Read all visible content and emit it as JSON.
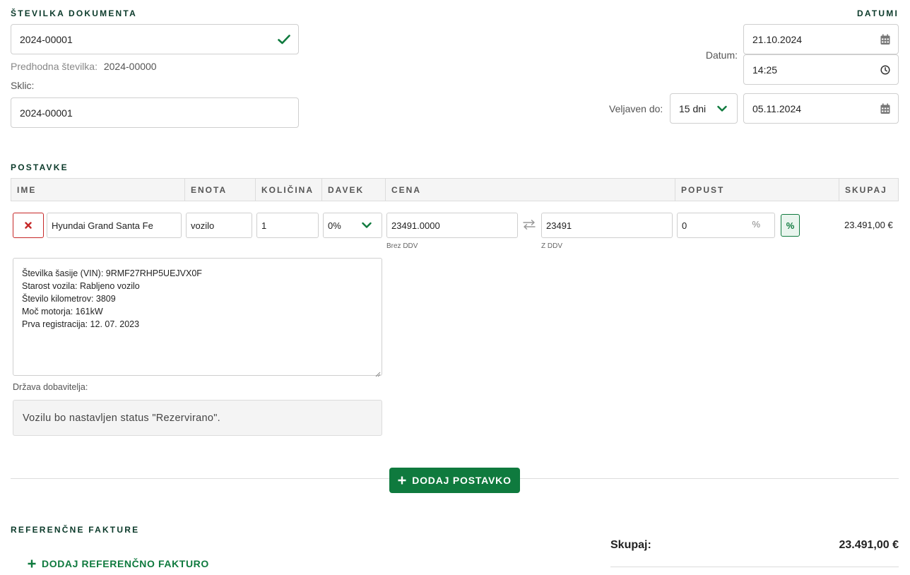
{
  "document": {
    "heading": "ŠTEVILKA DOKUMENTA",
    "number_value": "2024-00001",
    "previous_label": "Predhodna številka:",
    "previous_value": "2024-00000",
    "reference_label": "Sklic:",
    "reference_value": "2024-00001"
  },
  "dates": {
    "heading": "DATUMI",
    "date_label": "Datum:",
    "date_value": "21.10.2024",
    "time_value": "14:25",
    "valid_label": "Veljaven do:",
    "valid_days": "15 dni",
    "valid_date": "05.11.2024"
  },
  "items": {
    "heading": "POSTAVKE",
    "columns": [
      "IME",
      "ENOTA",
      "KOLIČINA",
      "DAVEK",
      "CENA",
      "POPUST",
      "SKUPAJ"
    ],
    "row": {
      "name": "Hyundai Grand Santa Fe",
      "unit": "vozilo",
      "quantity": "1",
      "tax": "0%",
      "price_net": "23491.0000",
      "price_net_note": "Brez DDV",
      "price_gross": "23491",
      "price_gross_note": "Z DDV",
      "discount": "0",
      "discount_unit": "%",
      "discount_toggle": "%",
      "total": "23.491,00 €",
      "description": "Številka šasije (VIN): 9RMF27RHP5UEJVX0F\nStarost vozila: Rabljeno vozilo\nŠtevilo kilometrov: 3809\nMoč motorja: 161kW\nPrva registracija: 12. 07. 2023",
      "supplier_country_label": "Država dobavitelja:",
      "status_notice": "Vozilu bo nastavljen status \"Rezervirano\"."
    },
    "add_button": "DODAJ POSTAVKO"
  },
  "reference_invoices": {
    "heading": "REFERENČNE FAKTURE",
    "add_link": "DODAJ REFERENČNO FAKTURO"
  },
  "summary": {
    "total_label": "Skupaj:",
    "total_value": "23.491,00 €"
  },
  "colors": {
    "accent": "#0f7a3e",
    "danger": "#c62828",
    "heading": "#0b3a2a"
  },
  "icons": {
    "check": "check-icon",
    "calendar": "calendar-icon",
    "clock": "clock-icon",
    "chevron": "chevron-down-icon",
    "remove": "close-icon",
    "swap": "swap-arrows-icon",
    "plus": "plus-icon"
  }
}
